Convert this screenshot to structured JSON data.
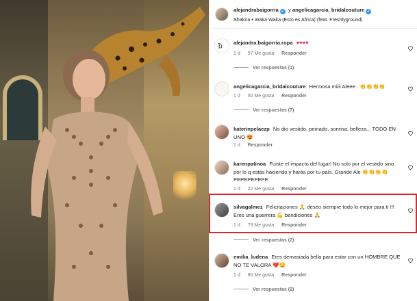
{
  "header": {
    "user1": "alejandrabaigorria",
    "conj": "y",
    "user2": "angelicagarcia_bridalcouture",
    "audio": "Shakira • Waka Waka (Esto es Africa) (feat. Freshlyground)"
  },
  "comments": [
    {
      "user": "alejandra.baigorria.ropa",
      "text": "♥♥♥♥",
      "time": "1 d",
      "likes": "57 Me gusta",
      "reply": "Responder",
      "more_replies": "Ver respuestas (1)"
    },
    {
      "user": "angelicagarcia_bridalcouture",
      "text": "Hermosa miiii Aleee . 👏👏👏👏",
      "time": "1 d",
      "likes": "50 Me gusta",
      "reply": "Responder",
      "more_replies": "Ver respuestas (7)"
    },
    {
      "user": "katerinpelaezp",
      "text": "No dio vestido, peinado, sonrisa, belleza... TODO EN UNO 😍",
      "time": "1 d",
      "likes": "",
      "reply": "Responder",
      "more_replies": ""
    },
    {
      "user": "karenpatinoa",
      "text": "Fuiste el impacto del lugar! No solo por el vestido sino por lo q estás haciendo y harás por tu país. Grande Ale 👏👏👏👏 PEPEPEPEPE",
      "time": "1 d",
      "likes": "22 Me gusta",
      "reply": "Responder",
      "more_replies": ""
    },
    {
      "user": "silvagalmez",
      "text": "Felicitaciones 🙏 deseo siempre todo lo mejor para ti !!! Eres una guerrera 💪 bendiciones 🙏",
      "time": "1 d",
      "likes": "79 Me gusta",
      "reply": "Responder",
      "more_replies": "Ver respuestas (2)"
    },
    {
      "user": "emilia_ludena",
      "text": "Eres demasiada bella para estar con un HOMBRE QUE NO TE VALORA ❤️😏",
      "time": "1 d",
      "likes": "85 Me gusta",
      "reply": "Responder",
      "more_replies": "Ver respuestas (2)"
    }
  ],
  "colors": {
    "highlight": "#d9262c",
    "verified": "#3797f0",
    "muted": "#737373"
  }
}
